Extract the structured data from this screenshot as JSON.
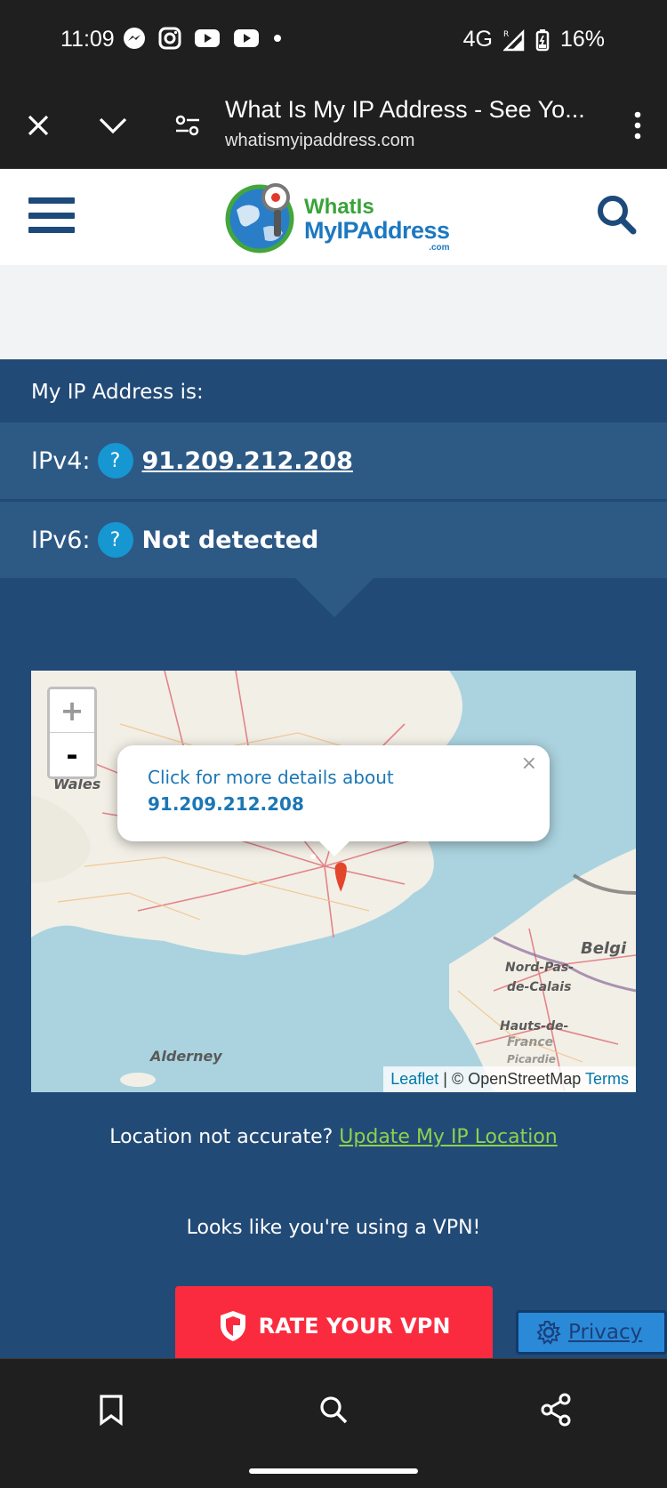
{
  "status_bar": {
    "time": "11:09",
    "network": "4G",
    "roaming": "R",
    "battery": "16%",
    "notification_icons": [
      "messenger-icon",
      "instagram-icon",
      "youtube-icon",
      "youtube-icon",
      "dot-icon"
    ]
  },
  "browser": {
    "page_title": "What Is My IP Address - See Yo...",
    "url": "whatismyipaddress.com"
  },
  "site": {
    "logo": {
      "line1": "WhatIs",
      "line2": "MyIPAddress",
      "line3": ".com"
    }
  },
  "ip": {
    "heading": "My IP Address is:",
    "ipv4_label": "IPv4:",
    "ipv4_value": "91.209.212.208",
    "ipv6_label": "IPv6:",
    "ipv6_value": "Not detected",
    "help_glyph": "?"
  },
  "map": {
    "zoom_in": "+",
    "zoom_out": "-",
    "popup_line1": "Click for more details about",
    "popup_ip": "91.209.212.208",
    "popup_close": "×",
    "attribution_leaflet": "Leaflet",
    "attribution_sep": " | © OpenStreetMap ",
    "attribution_terms": "Terms",
    "labels": {
      "wales": "Wales",
      "alderney": "Alderney",
      "belgium": "Belgi",
      "nord1": "Nord-Pas-",
      "nord2": "de-Calais",
      "hauts": "Hauts-de-",
      "france": "France",
      "picardie": "Picardie"
    }
  },
  "location": {
    "question": "Location not accurate? ",
    "update_link": "Update My IP Location"
  },
  "vpn": {
    "notice": "Looks like you're using a VPN!",
    "rate_button": "RATE YOUR VPN"
  },
  "privacy": {
    "label": "Privacy"
  },
  "colors": {
    "main_bg": "#224a76",
    "row_bg": "#2d5985",
    "rate_button": "#fa2b3e",
    "link_green": "#8ed14e",
    "help_blue": "#1697d2"
  }
}
